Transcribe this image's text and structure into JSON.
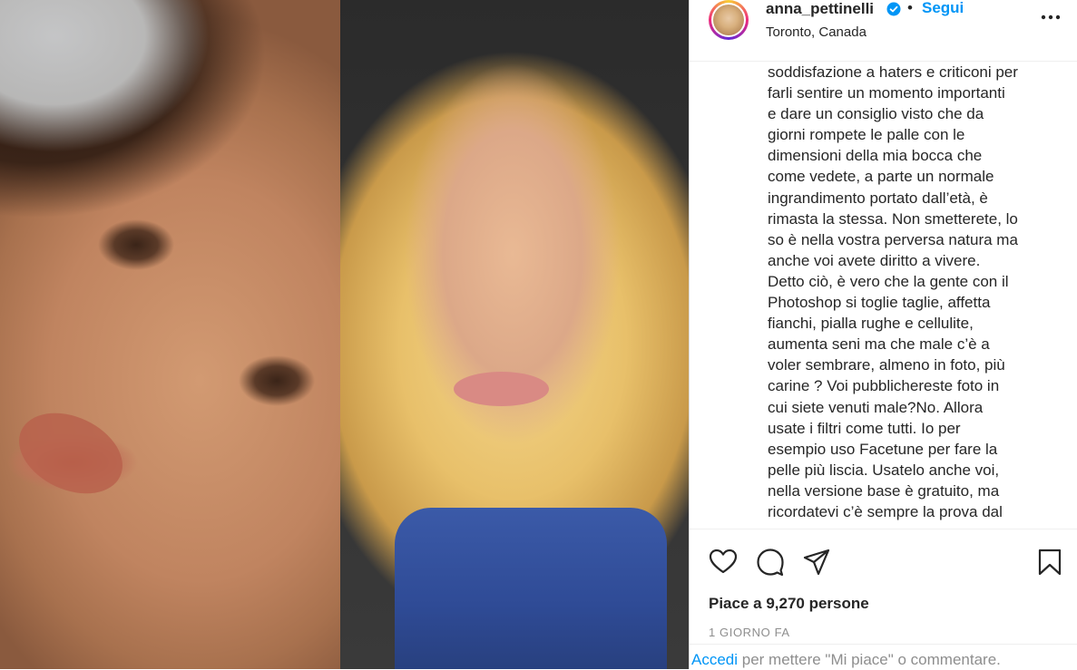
{
  "post": {
    "username": "anna_pettinelli",
    "follow_label": "Segui",
    "dot": "•",
    "location": "Toronto, Canada",
    "caption_lines": [
      "soddisfazione a haters e criticoni per",
      "farli sentire un momento importanti",
      "e dare un consiglio visto che da",
      "giorni rompete le palle con le",
      "dimensioni della mia bocca che",
      "come vedete, a parte un normale",
      "ingrandimento portato dall’età, è",
      "rimasta la stessa. Non smetterete, lo",
      "so è nella vostra perversa natura ma",
      "anche voi avete diritto a vivere.",
      "Detto ciò, è vero che la gente con il",
      "Photoshop si toglie taglie, affetta",
      "fianchi, pialla rughe e cellulite,",
      "aumenta seni ma che male c’è a",
      "voler sembrare, almeno in foto, più",
      "carine ? Voi pubblichereste foto in",
      "cui siete venuti male?No. Allora",
      "usate i filtri come tutti. Io per",
      "esempio uso Facetune per fare la",
      "pelle più liscia. Usatelo anche voi,",
      "nella versione base è gratuito, ma",
      "ricordatevi c’è sempre la prova dal"
    ],
    "likes": "Piace a 9,270 persone",
    "time_ago": "1 GIORNO FA",
    "login_link": "Accedi",
    "login_rest": " per mettere \"Mi piace\" o commentare."
  },
  "icons": {
    "verified": "verified-badge-icon",
    "more": "more-options-icon",
    "like": "heart-icon",
    "comment": "comment-icon",
    "share": "share-icon",
    "save": "bookmark-icon"
  },
  "colors": {
    "link_blue": "#0095f6",
    "text": "#262626",
    "muted": "#8e8e8e"
  }
}
